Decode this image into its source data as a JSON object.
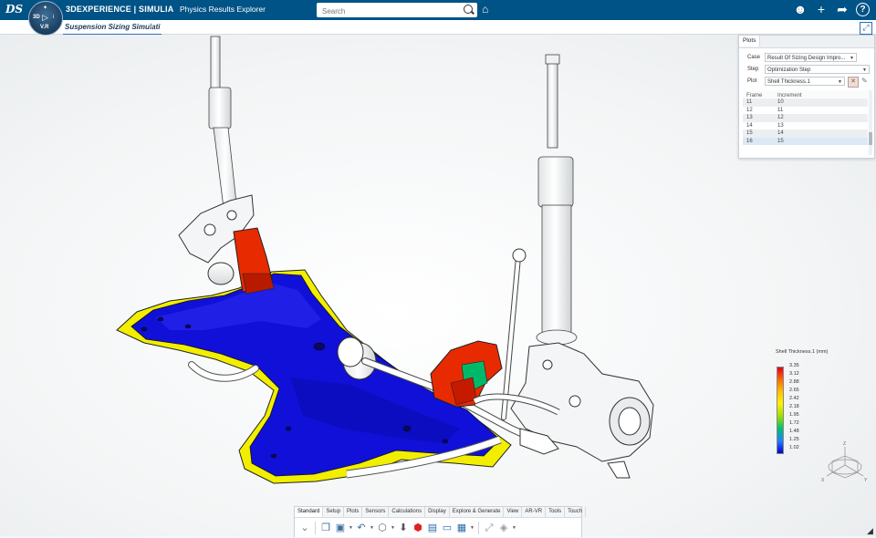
{
  "app": {
    "brand_main": "3DEXPERIENCE | SIMULIA",
    "brand_sub": "Physics Results Explorer",
    "compass": {
      "top": "✦",
      "left": "3D",
      "center": "▷",
      "right": "i",
      "version": "V.R"
    },
    "logo": "DS"
  },
  "search": {
    "placeholder": "Search",
    "icon": "search-icon"
  },
  "topbar_icons": [
    "user-icon",
    "plus-icon",
    "share-icon",
    "help-icon"
  ],
  "tab": {
    "label": "Suspension Sizing Simulati",
    "add": "+"
  },
  "plots_panel": {
    "tab_label": "Plots",
    "case_label": "Case",
    "case_value": "Result Of Sizing Design Impro...",
    "step_label": "Step",
    "step_value": "Optimization Step",
    "plot_label": "Plot",
    "plot_value": "Shell Thickness.1",
    "columns": [
      "Frame",
      "Increment"
    ],
    "rows": [
      {
        "frame": "11",
        "increment": "10"
      },
      {
        "frame": "12",
        "increment": "11"
      },
      {
        "frame": "13",
        "increment": "12"
      },
      {
        "frame": "14",
        "increment": "13"
      },
      {
        "frame": "15",
        "increment": "14"
      },
      {
        "frame": "16",
        "increment": "15"
      }
    ],
    "selected_row": 5
  },
  "legend": {
    "title": "Shell Thickness.1 (mm)",
    "values": [
      "3.35",
      "3.12",
      "2.88",
      "2.65",
      "2.42",
      "2.18",
      "1.95",
      "1.72",
      "1.48",
      "1.25",
      "1.02"
    ],
    "colors": {
      "max": "#e3001b",
      "min": "#0000cc"
    }
  },
  "triad": {
    "z": "Z",
    "x": "X",
    "y": "Y"
  },
  "bottom_tabs": [
    "Standard",
    "Setup",
    "Plots",
    "Sensors",
    "Calculations",
    "Display",
    "Explore & Generate",
    "View",
    "AR-VR",
    "Tools",
    "Touch"
  ],
  "active_bottom_tab": "Standard",
  "colors": {
    "topbar": "#005386",
    "accent": "#2b6fb5",
    "part_blue": "#1010d8",
    "part_red": "#e82a00",
    "part_yellow": "#f2ee00"
  }
}
